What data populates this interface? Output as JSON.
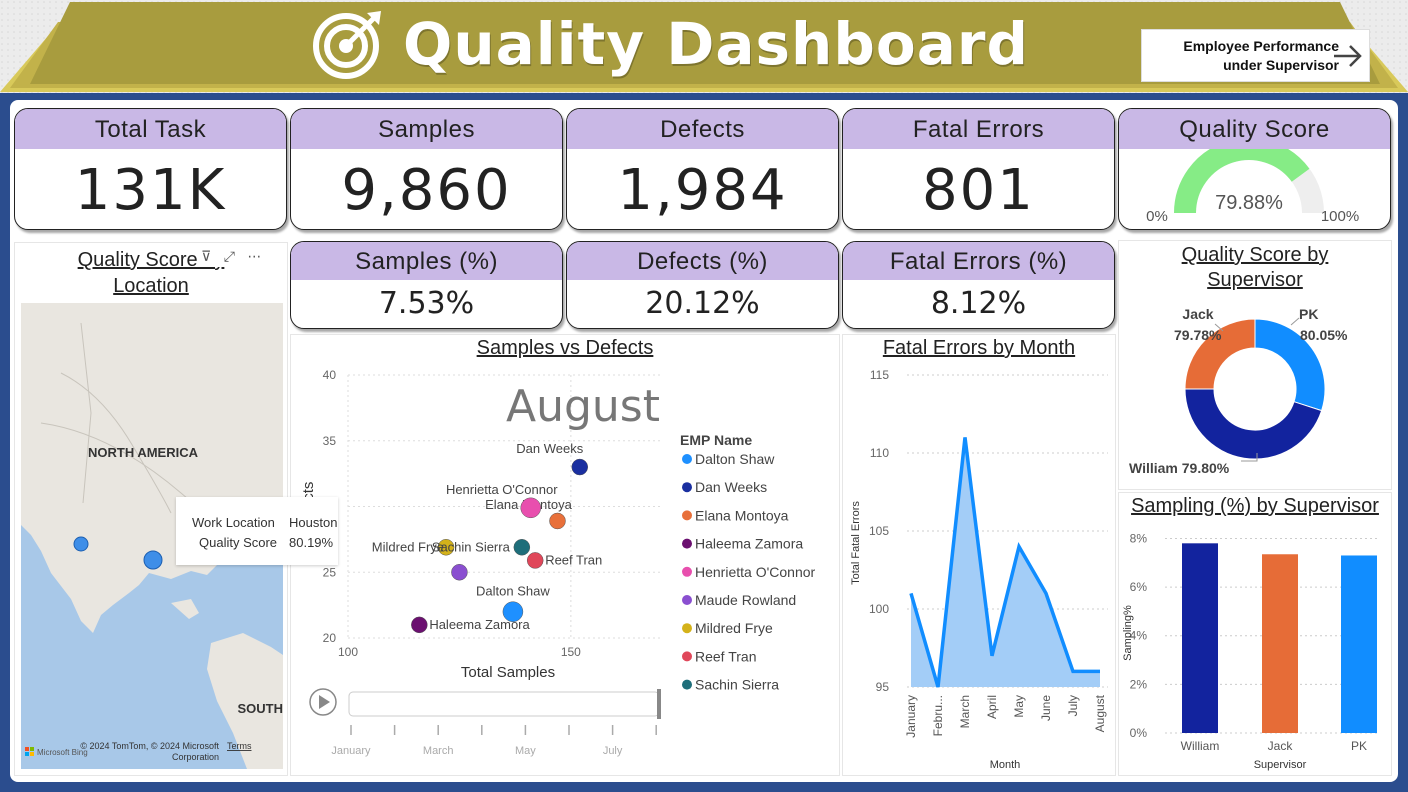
{
  "header": {
    "title": "Quality Dashboard",
    "nav_button": "Employee Performance under Supervisor",
    "nav_line1": "Employee Performance",
    "nav_line2": "under Supervisor"
  },
  "kpis": [
    {
      "label": "Total Task",
      "value": "131K"
    },
    {
      "label": "Samples",
      "value": "9,860"
    },
    {
      "label": "Defects",
      "value": "1,984"
    },
    {
      "label": "Fatal Errors",
      "value": "801"
    }
  ],
  "quality_gauge": {
    "label": "Quality Score",
    "value": "79.88%",
    "min_label": "0%",
    "max_label": "100%",
    "fraction": 0.7988,
    "color": "#86ec86"
  },
  "pct_kpis": [
    {
      "label": "Samples (%)",
      "value": "7.53%"
    },
    {
      "label": "Defects (%)",
      "value": "20.12%"
    },
    {
      "label": "Fatal Errors (%)",
      "value": "8.12%"
    }
  ],
  "map": {
    "title_line1": "Quality Score by",
    "title_line2": "Location",
    "continent_1": "NORTH AMERICA",
    "continent_2": "SOUTH",
    "tooltip": {
      "k1": "Work Location",
      "v1": "Houston",
      "k2": "Quality Score",
      "v2": "80.19%"
    },
    "attribution": "© 2024 TomTom, © 2024 Microsoft Corporation",
    "attr_line1": "© 2024 TomTom, © 2024 Microsoft",
    "attr_line2": "Corporation",
    "terms": "Terms",
    "bing": "Microsoft Bing"
  },
  "scatter": {
    "title": "Samples vs Defects",
    "frame_label": "August",
    "xlabel": "Total Samples",
    "ylabel": "Defects",
    "legend_title": "EMP Name",
    "timeline_labels": [
      "January",
      "March",
      "May",
      "July"
    ]
  },
  "fatal_chart": {
    "title": "Fatal Errors by Month",
    "xlabel": "Month",
    "ylabel": "Total Fatal Errors"
  },
  "donut": {
    "title_line1": "Quality Score by",
    "title_line2": "Supervisor",
    "labels": [
      {
        "name": "Jack",
        "value": "79.78%"
      },
      {
        "name": "PK",
        "value": "80.05%"
      },
      {
        "name": "William 79.80%"
      }
    ]
  },
  "bars": {
    "title": "Sampling (%) by Supervisor",
    "xlabel": "Supervisor",
    "ylabel": "Sampling%"
  },
  "chart_data": [
    {
      "type": "scatter",
      "title": "Samples vs Defects",
      "xlabel": "Total Samples",
      "ylabel": "Defects",
      "xlim": [
        100,
        170
      ],
      "ylim": [
        20,
        40
      ],
      "x_ticks": [
        100,
        150
      ],
      "y_ticks": [
        20,
        25,
        30,
        35,
        40
      ],
      "series": [
        {
          "name": "Dalton Shaw",
          "x": 137,
          "y": 22,
          "color": "#1e90ff"
        },
        {
          "name": "Dan Weeks",
          "x": 152,
          "y": 33,
          "color": "#1a2fa0"
        },
        {
          "name": "Elana Montoya",
          "x": 147,
          "y": 28.9,
          "color": "#e8703a"
        },
        {
          "name": "Haleema Zamora",
          "x": 116,
          "y": 21,
          "color": "#6b1070"
        },
        {
          "name": "Henrietta O'Connor",
          "x": 141,
          "y": 29.9,
          "color": "#e84fae"
        },
        {
          "name": "Maude Rowland",
          "x": 125,
          "y": 25,
          "color": "#8a4fd0"
        },
        {
          "name": "Mildred Frye",
          "x": 122,
          "y": 26.9,
          "color": "#d4b21a"
        },
        {
          "name": "Reef Tran",
          "x": 142,
          "y": 25.9,
          "color": "#e0475a"
        },
        {
          "name": "Sachin Sierra",
          "x": 139,
          "y": 26.9,
          "color": "#1e6e7a"
        }
      ]
    },
    {
      "type": "area",
      "title": "Fatal Errors by Month",
      "xlabel": "Month",
      "ylabel": "Total Fatal Errors",
      "categories": [
        "January",
        "Febru...",
        "March",
        "April",
        "May",
        "June",
        "July",
        "August"
      ],
      "values": [
        101,
        95,
        111,
        97,
        104,
        101,
        96,
        96
      ],
      "ylim": [
        95,
        115
      ],
      "y_ticks": [
        95,
        100,
        105,
        110,
        115
      ]
    },
    {
      "type": "pie",
      "title": "Quality Score by Supervisor",
      "categories": [
        "PK",
        "William",
        "Jack"
      ],
      "values": [
        80.05,
        79.8,
        79.78
      ],
      "shares": [
        0.3,
        0.45,
        0.25
      ],
      "colors": [
        "#118dff",
        "#12239e",
        "#e66c37"
      ]
    },
    {
      "type": "bar",
      "title": "Sampling (%) by Supervisor",
      "xlabel": "Supervisor",
      "ylabel": "Sampling%",
      "categories": [
        "William",
        "Jack",
        "PK"
      ],
      "values": [
        7.8,
        7.35,
        7.3
      ],
      "ylim": [
        0,
        8.8
      ],
      "y_ticks": [
        "0%",
        "2%",
        "4%",
        "6%",
        "8%"
      ],
      "colors": [
        "#12239e",
        "#e66c37",
        "#118dff"
      ]
    }
  ]
}
